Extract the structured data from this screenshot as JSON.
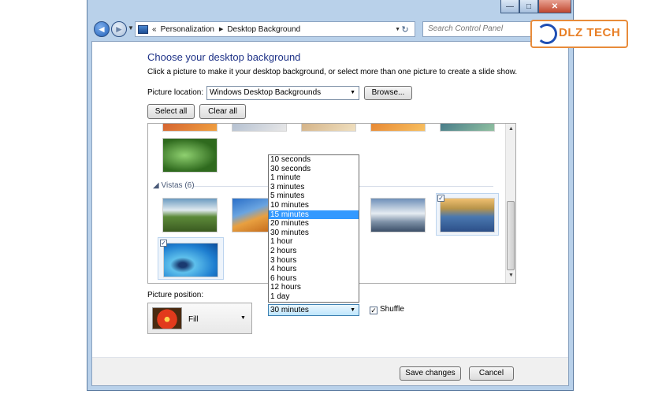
{
  "window": {
    "caption_buttons": {
      "minimize": "—",
      "maximize": "□",
      "close": "✕"
    }
  },
  "navbar": {
    "back_glyph": "◄",
    "forward_glyph": "►",
    "breadcrumb_prefix": "«",
    "breadcrumb": [
      "Personalization",
      "Desktop Background"
    ],
    "search_placeholder": "Search Control Panel"
  },
  "main": {
    "heading": "Choose your desktop background",
    "subtext": "Click a picture to make it your desktop background, or select more than one picture to create a slide show.",
    "picture_location_label": "Picture location:",
    "picture_location_value": "Windows Desktop Backgrounds",
    "browse_label": "Browse...",
    "select_all_label": "Select all",
    "clear_all_label": "Clear all",
    "group_label": "Vistas (6)",
    "picture_position_label": "Picture position:",
    "picture_position_value": "Fill",
    "change_every": {
      "options": [
        "10 seconds",
        "30 seconds",
        "1 minute",
        "3 minutes",
        "5 minutes",
        "10 minutes",
        "15 minutes",
        "20 minutes",
        "30 minutes",
        "1 hour",
        "2 hours",
        "3 hours",
        "4 hours",
        "6 hours",
        "12 hours",
        "1 day"
      ],
      "highlighted": "15 minutes",
      "selected": "30 minutes"
    },
    "shuffle_label": "Shuffle",
    "shuffle_checked": true,
    "save_label": "Save changes",
    "cancel_label": "Cancel"
  },
  "watermark": {
    "text": "DLZ TECH"
  },
  "icons": {
    "check": "✓",
    "dropdown": "▼",
    "refresh": "↻",
    "scroll_up": "▲",
    "scroll_down": "▼"
  },
  "colors": {
    "heading": "#1e3287",
    "highlight": "#3399ff",
    "window_frame": "#b9d1ea"
  }
}
